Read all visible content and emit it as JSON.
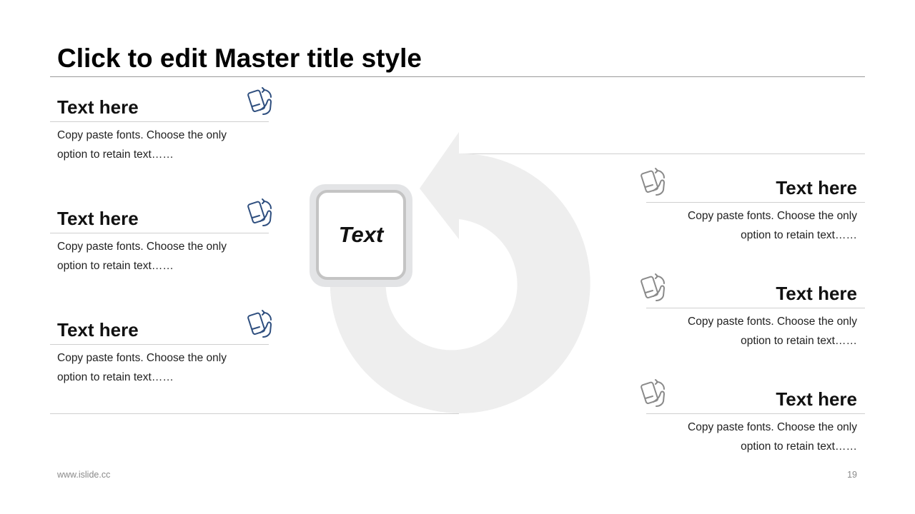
{
  "title": "Click to edit Master title style",
  "center": {
    "label": "Text"
  },
  "left_items": [
    {
      "heading": "Text here",
      "body": "Copy paste fonts. Choose the only option to retain text……",
      "icon": "phone-rotate-icon"
    },
    {
      "heading": "Text here",
      "body": "Copy paste fonts. Choose the only option to retain text……",
      "icon": "phone-rotate-icon"
    },
    {
      "heading": "Text here",
      "body": "Copy paste fonts. Choose the only option to retain text……",
      "icon": "phone-rotate-icon"
    }
  ],
  "right_items": [
    {
      "heading": "Text here",
      "body": "Copy paste fonts. Choose the only option to retain text……",
      "icon": "phone-rotate-icon"
    },
    {
      "heading": "Text here",
      "body": "Copy paste fonts. Choose the only option to retain text……",
      "icon": "phone-rotate-icon"
    },
    {
      "heading": "Text here",
      "body": "Copy paste fonts. Choose the only option to retain text……",
      "icon": "phone-rotate-icon"
    }
  ],
  "footer": {
    "url": "www.islide.cc",
    "page_number": "19"
  },
  "colors": {
    "icon_left": "#2f4f7f",
    "icon_right": "#8a8a8a",
    "arrow": "#eeeeee"
  }
}
